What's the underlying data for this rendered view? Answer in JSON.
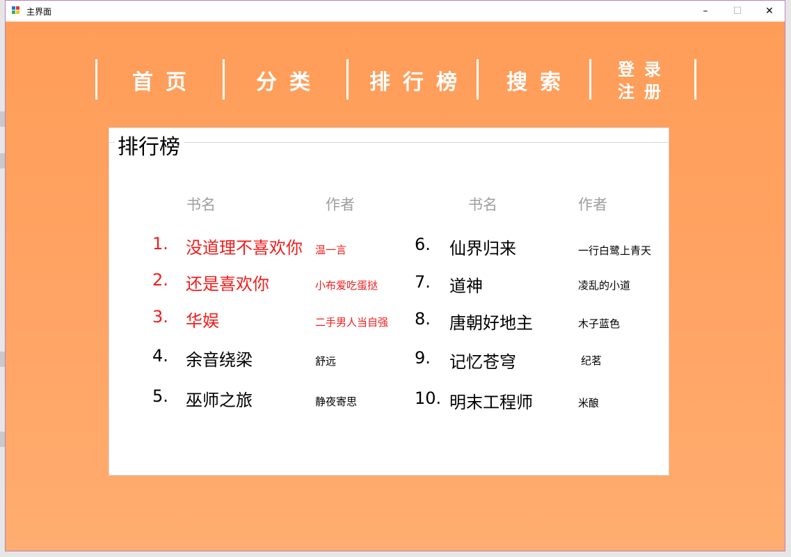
{
  "window": {
    "title": "主界面",
    "minimize_label": "–",
    "maximize_label": "☐",
    "close_label": "✕"
  },
  "nav": {
    "home": "首页",
    "category": "分类",
    "ranking": "排行榜",
    "search": "搜索",
    "login_line1": "登录",
    "login_line2": "注册"
  },
  "panel": {
    "title": "排行榜",
    "headers": {
      "left_book": "书名",
      "left_author": "作者",
      "right_book": "书名",
      "right_author": "作者"
    },
    "left": [
      {
        "rank": "1.",
        "book": "没道理不喜欢你",
        "author": "温一言"
      },
      {
        "rank": "2.",
        "book": "还是喜欢你",
        "author": "小布爱吃蛋挞"
      },
      {
        "rank": "3.",
        "book": "华娱",
        "author": "二手男人当自强"
      },
      {
        "rank": "4.",
        "book": "余音绕梁",
        "author": "舒远"
      },
      {
        "rank": "5.",
        "book": "巫师之旅",
        "author": "静夜寄思"
      }
    ],
    "right": [
      {
        "rank": "6.",
        "book": "仙界归来",
        "author": "一行白鹭上青天"
      },
      {
        "rank": "7.",
        "book": "道神",
        "author": "凌乱的小道"
      },
      {
        "rank": "8.",
        "book": "唐朝好地主",
        "author": "木子蓝色"
      },
      {
        "rank": "9.",
        "book": "记忆苍穹",
        "author": "纪茗"
      },
      {
        "rank": "10.",
        "book": "明末工程师",
        "author": "米酿"
      }
    ]
  },
  "colors": {
    "background": "#ffa25c",
    "top_rank": "#f21c1c",
    "header_text": "#9e9e9e"
  }
}
